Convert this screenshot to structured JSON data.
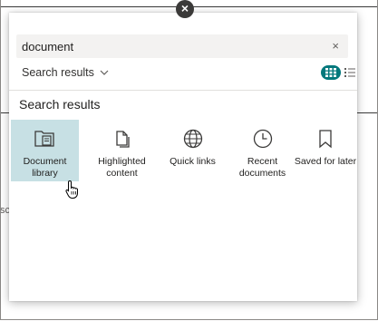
{
  "background": {
    "stub_text": "sc"
  },
  "panel": {
    "close_glyph": "×",
    "search": {
      "value": "document",
      "clear_glyph": "×"
    },
    "results_dropdown": {
      "label": "Search results",
      "chevron": "⌄"
    },
    "view_toggle": {
      "grid_icon": "grid-icon",
      "list_icon": "list-icon",
      "active_color": "#03787c"
    },
    "section_title": "Search results",
    "tiles": [
      {
        "label": "Document library",
        "icon": "document-library-icon",
        "selected": true
      },
      {
        "label": "Highlighted content",
        "icon": "highlighted-content-icon",
        "selected": false
      },
      {
        "label": "Quick links",
        "icon": "globe-icon",
        "selected": false
      },
      {
        "label": "Recent documents",
        "icon": "clock-icon",
        "selected": false
      },
      {
        "label": "Saved for later",
        "icon": "bookmark-icon",
        "selected": false
      }
    ],
    "selected_color": "#c7e0e4"
  }
}
